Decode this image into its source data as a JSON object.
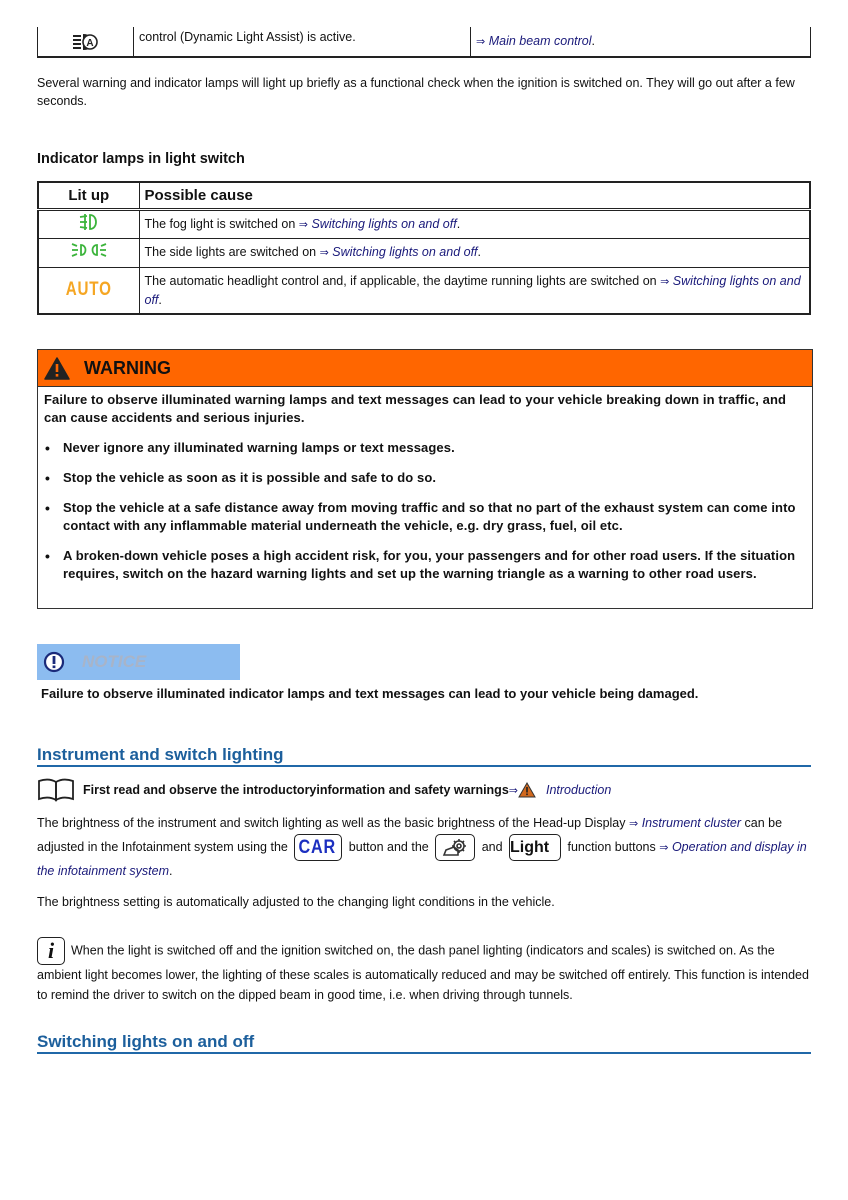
{
  "top_table": {
    "icon": "main-beam-auto-icon",
    "cause_text": "control (Dynamic Light Assist) is active.",
    "link_arrow": "⇒",
    "link_text": "Main beam control",
    "link_suffix": "."
  },
  "functional_check_text": "Several warning and indicator lamps will light up briefly as a functional check when the ignition is switched on. They will go out after a few seconds.",
  "indicator_section": {
    "title": "Indicator lamps in light switch",
    "headers": [
      "Lit up",
      "Possible cause"
    ],
    "rows": [
      {
        "icon": "fog-light-icon",
        "text": "The fog light is switched on ",
        "arrow": "⇒",
        "link": "Switching lights on and off",
        "suffix": "."
      },
      {
        "icon": "side-lights-icon",
        "text": "The side lights are switched on ",
        "arrow": "⇒",
        "link": "Switching lights on and off",
        "suffix": "."
      },
      {
        "icon": "auto-headlight-icon",
        "icon_text": "AUTO",
        "text": "The automatic headlight control and, if applicable, the daytime running lights are switched on ",
        "arrow": "⇒",
        "link": "Switching lights on and off",
        "suffix": "."
      }
    ]
  },
  "warning": {
    "title": "WARNING",
    "intro": "Failure to observe illuminated warning lamps and text messages can lead to your vehicle breaking down in traffic, and can cause accidents and serious injuries.",
    "bullets": [
      "Never ignore any illuminated warning lamps or text messages.",
      "Stop the vehicle as soon as it is possible and safe to do so.",
      "Stop the vehicle at a safe distance away from moving traffic and so that no part of the exhaust system can come into contact with any inflammable material underneath the vehicle, e.g. dry grass, fuel, oil etc.",
      "A broken-down vehicle poses a high accident risk, for you, your passengers and for other road users. If the situation requires, switch on the hazard warning lights and set up the warning triangle as a warning to other road users."
    ]
  },
  "notice": {
    "title": "NOTICE",
    "text": "Failure to observe illuminated indicator lamps and text messages can lead to your vehicle being damaged."
  },
  "instrument_section": {
    "title": "Instrument and switch lighting",
    "intro_text": "First read and observe the introductoryinformation and safety warnings",
    "intro_arrow": "⇒",
    "intro_link": "Introduction",
    "para1_a": "The brightness of the instrument and switch lighting as well as the basic brightness of the Head-up Display ",
    "para1_link1": "Instrument cluster",
    "para1_b": " can be adjusted in the Infotainment system using the ",
    "car_button": "CAR",
    "para1_c": " button and the ",
    "para1_d": " and ",
    "light_button": "Light",
    "para1_e": " function buttons ",
    "para1_link2": "Operation and display in the infotainment system",
    "para1_suffix": ".",
    "arrow": "⇒",
    "para2": "The brightness setting is automatically adjusted to the changing light conditions in the vehicle.",
    "info_icon": "i",
    "info_text": "When the light is switched off and the ignition switched on, the dash panel lighting (indicators and scales) is switched on. As the ambient light becomes lower, the lighting of these scales is automatically reduced and may be switched off entirely. This function is intended to remind the driver to switch on the dipped beam in good time, i.e. when driving through tunnels."
  },
  "switching_section": {
    "title": "Switching lights on and off"
  },
  "colors": {
    "warning_header": "#ff6600",
    "notice_header": "#8cbcf0",
    "section_heading": "#1c5f9c",
    "link": "#1a1a7a",
    "indicator_green": "#3cb43c",
    "indicator_amber": "#f5a623"
  }
}
